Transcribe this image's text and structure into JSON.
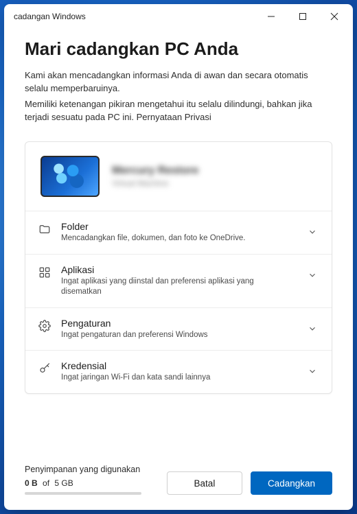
{
  "window": {
    "title": "cadangan Windows"
  },
  "page": {
    "heading": "Mari cadangkan PC Anda",
    "intro_line1": "Kami akan mencadangkan informasi Anda di awan dan secara otomatis selalu memperbaruinya.",
    "intro_line2_pre": "Memiliki ketenangan pikiran mengetahui itu selalu dilindungi, bahkan jika terjadi sesuatu pada PC ini. ",
    "privacy_link": "Pernyataan Privasi"
  },
  "device": {
    "name": "Mercury Restore",
    "subtitle": "Virtual Machine"
  },
  "items": [
    {
      "icon": "folder-icon",
      "title": "Folder",
      "subtitle": "Mencadangkan file, dokumen, dan foto ke OneDrive."
    },
    {
      "icon": "apps-icon",
      "title": "Aplikasi",
      "subtitle": "Ingat aplikasi yang diinstal dan preferensi aplikasi yang disematkan"
    },
    {
      "icon": "settings-icon",
      "title": "Pengaturan",
      "subtitle": "Ingat pengaturan dan preferensi Windows"
    },
    {
      "icon": "key-icon",
      "title": "Kredensial",
      "subtitle": "Ingat jaringan Wi-Fi dan kata sandi lainnya"
    }
  ],
  "storage": {
    "label": "Penyimpanan yang digunakan",
    "used": "0 B",
    "of_word": "of",
    "total": "5 GB",
    "percent": 0
  },
  "buttons": {
    "cancel": "Batal",
    "backup": "Cadangkan"
  }
}
